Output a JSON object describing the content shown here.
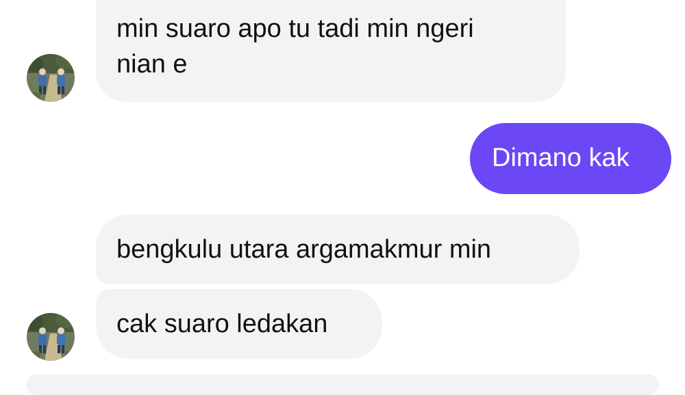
{
  "conversation": {
    "messages": [
      {
        "sender": "other",
        "text": "min suaro apo tu tadi min ngeri\nnian e"
      },
      {
        "sender": "me",
        "text": "Dimano kak"
      },
      {
        "sender": "other",
        "text": "bengkulu utara argamakmur min"
      },
      {
        "sender": "other",
        "text": "cak suaro ledakan"
      }
    ]
  },
  "colors": {
    "incoming_bubble": "#f2f3f5",
    "outgoing_bubble": "#6c47f5",
    "incoming_text": "#111111",
    "outgoing_text": "#ffffff"
  }
}
